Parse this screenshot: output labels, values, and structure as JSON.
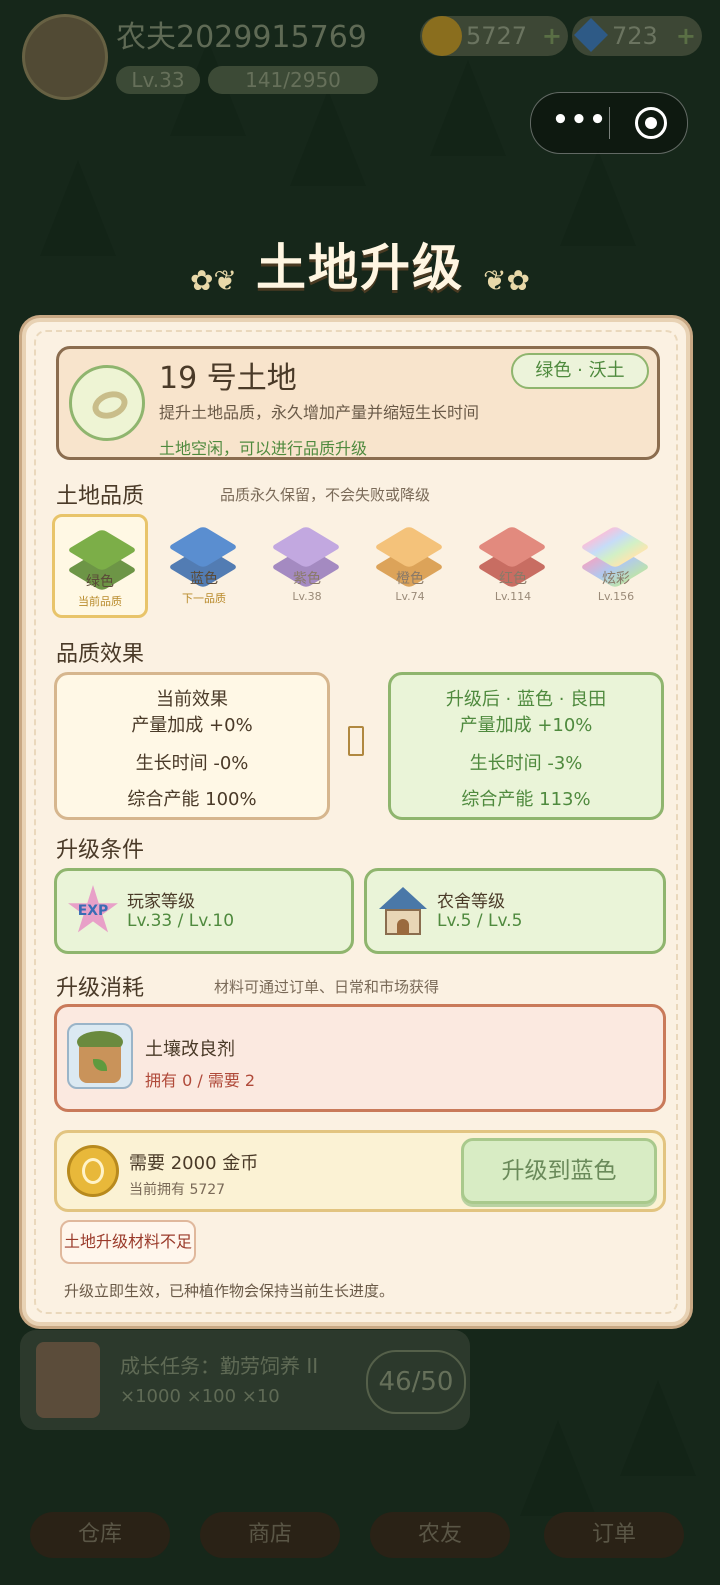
{
  "hud": {
    "player_name": "农夫2029915769",
    "level": "Lv.33",
    "exp": "141/2950",
    "gold": "5727",
    "gems": "723",
    "plus": "+"
  },
  "capsule": {
    "more": "•••"
  },
  "title": "土地升级",
  "land": {
    "title": "19 号土地",
    "badge": "绿色 · 沃土",
    "desc": "提升土地品质，永久增加产量并缩短生长时间",
    "status": "土地空闲，可以进行品质升级"
  },
  "quality": {
    "title": "土地品质",
    "note": "品质永久保留，不会失败或降级",
    "tiles": [
      {
        "name": "绿色",
        "sub": "当前品质",
        "color": "#7cae48"
      },
      {
        "name": "蓝色",
        "sub": "下一品质",
        "color": "#5a8ed0"
      },
      {
        "name": "紫色",
        "sub": "Lv.38",
        "color": "#b79ad8"
      },
      {
        "name": "橙色",
        "sub": "Lv.74",
        "color": "#f2b866"
      },
      {
        "name": "红色",
        "sub": "Lv.114",
        "color": "#de7e72"
      },
      {
        "name": "炫彩",
        "sub": "Lv.156",
        "color": "#f0c8e8"
      }
    ]
  },
  "effects": {
    "title": "品质效果",
    "current": {
      "head": "当前效果",
      "yield": "产量加成 +0%",
      "time": "生长时间 -0%",
      "total": "综合产能 100%"
    },
    "next": {
      "head": "升级后 · 蓝色 · 良田",
      "yield": "产量加成 +10%",
      "time": "生长时间 -3%",
      "total": "综合产能 113%"
    }
  },
  "conditions": {
    "title": "升级条件",
    "player": {
      "label": "玩家等级",
      "value": "Lv.33 / Lv.10",
      "icon_text": "EXP"
    },
    "farmhouse": {
      "label": "农舍等级",
      "value": "Lv.5 / Lv.5"
    }
  },
  "cost": {
    "title": "升级消耗",
    "note": "材料可通过订单、日常和市场获得",
    "material": {
      "name": "土壤改良剂",
      "have": "拥有 0 / 需要 2"
    },
    "gold_need": "需要 2000 金币",
    "gold_have": "当前拥有 5727",
    "button": "升级到蓝色"
  },
  "warning": "土地升级材料不足",
  "footnote": "升级立即生效，已种植作物会保持当前生长进度。",
  "background": {
    "task_title": "成长任务：勤劳饲养 II",
    "task_rewards": "×1000  ×100  ×10",
    "task_count": "46/50",
    "nav": [
      "仓库",
      "商店",
      "农友",
      "订单"
    ]
  },
  "colors": {
    "accent_green": "#4f8a3e",
    "warn_red": "#9a3a2a",
    "panel": "#fbf1e2"
  }
}
